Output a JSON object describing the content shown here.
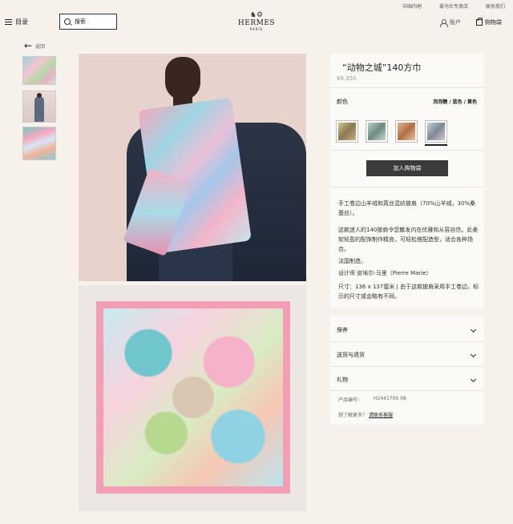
{
  "topbar": {
    "links": [
      "中国内地",
      "爱马仕专卖店",
      "联系我们"
    ]
  },
  "header": {
    "menu_label": "目录",
    "search_placeholder": "搜索",
    "logo": {
      "brand": "HERMES",
      "city": "PARIS"
    },
    "account_label": "账户",
    "cart_label": "购物袋"
  },
  "back_label": "返回",
  "product": {
    "title": "“动物之城”140方巾",
    "price": "¥8,350",
    "color_label": "颜色",
    "color_value": "泡泡糖 / 蓝色 / 黄色",
    "swatch_count": 4,
    "selected_swatch": 4,
    "add_to_bag": "加入购物袋",
    "description": [
      "手工卷边山羊绒和真丝混纺披肩（70%山羊绒，30%桑蚕丝）。",
      "这款迷人的140披肩令您散发内在优雅和从容自信。此柔软轻盈的配饰制作精良，可轻松搭配造型，适合各种场合。",
      "法国制造。",
      "设计师 皮埃尔-马里（Pierre Marie）",
      "尺寸：136 x 137厘米 | 由于这款披肩采用手工卷边，标示的尺寸或会略有不同。"
    ]
  },
  "accordion": {
    "items": [
      "保养",
      "送货与退货",
      "礼物"
    ],
    "sku_label": "产品编号：",
    "sku_value": "H244170S 08",
    "help_text": "想了解更多？",
    "help_link": "请联系客服"
  }
}
